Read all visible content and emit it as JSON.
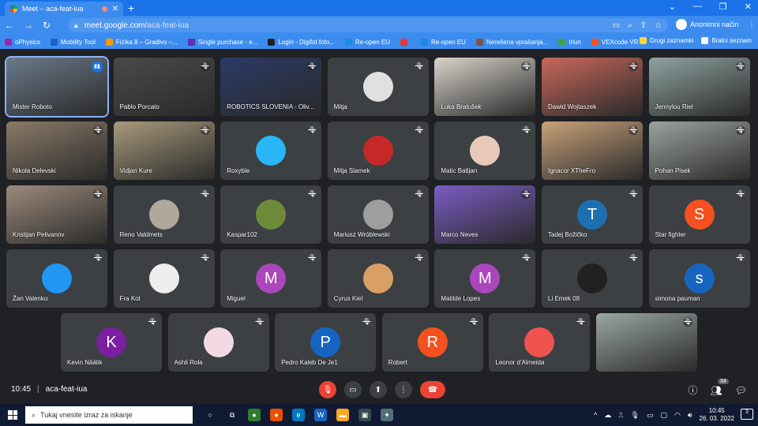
{
  "browser": {
    "tab_title": "Meet – aca-feat-iua",
    "url_host": "meet.google.com",
    "url_path": "/aca-feat-iua",
    "profile_label": "Anonimni način"
  },
  "bookmarks": [
    {
      "label": "oPhysics",
      "color": "#9c27b0"
    },
    {
      "label": "Mobility Tool",
      "color": "#1565c0"
    },
    {
      "label": "Fizika 8 – Gradivo –...",
      "color": "#ff9800"
    },
    {
      "label": "Single purchase - e...",
      "color": "#5e35b1"
    },
    {
      "label": "Login - Digifot foto...",
      "color": "#212121"
    },
    {
      "label": "Re-open EU",
      "color": "#1e88e5"
    },
    {
      "label": "",
      "color": "#e53935"
    },
    {
      "label": "Re-open EU",
      "color": "#1e88e5"
    },
    {
      "label": "Nerešena vprašanja...",
      "color": "#795548"
    },
    {
      "label": "Iriun",
      "color": "#43a047"
    },
    {
      "label": "VEXcode VR",
      "color": "#f4511e"
    }
  ],
  "bookmarks_right": {
    "other": "Drugi zaznamki",
    "reading": "Bralni seznam"
  },
  "participants": [
    {
      "name": "Mister Roboto",
      "type": "video",
      "bg": "#6b7a8a",
      "speaking": true
    },
    {
      "name": "Pablo Porcato",
      "type": "video",
      "bg": "#4a4a4a"
    },
    {
      "name": "ROBOTICS SLOVENIA - Oliv...",
      "type": "video",
      "bg": "#2b3a67"
    },
    {
      "name": "Mitja",
      "type": "avatar",
      "bg": "#e0e0e0",
      "initial": ""
    },
    {
      "name": "Luka Bratušek",
      "type": "video",
      "bg": "#d8d4cc"
    },
    {
      "name": "Dawid Wojtaszek",
      "type": "video",
      "bg": "#c8685a"
    },
    {
      "name": "Jennylou Riel",
      "type": "video",
      "bg": "#8fa3a0"
    },
    {
      "name": "Nikola Delevski",
      "type": "video",
      "bg": "#8a7a68"
    },
    {
      "name": "Vidjan Kure",
      "type": "video",
      "bg": "#a89a7c"
    },
    {
      "name": "Roxyble",
      "type": "avatar",
      "bg": "#29b6f6",
      "initial": ""
    },
    {
      "name": "Mitja Slamek",
      "type": "avatar",
      "bg": "#c62828",
      "initial": ""
    },
    {
      "name": "Matic Batljan",
      "type": "avatar",
      "bg": "#e8c9b8",
      "initial": ""
    },
    {
      "name": "Ignacor XTheFro",
      "type": "video",
      "bg": "#c9a27a"
    },
    {
      "name": "Pohan Pisek",
      "type": "video",
      "bg": "#9ba39f"
    },
    {
      "name": "Kristijan Pelivanov",
      "type": "video",
      "bg": "#9c8a7c"
    },
    {
      "name": "Reno Valdmets",
      "type": "avatar",
      "bg": "#b0a89a",
      "initial": ""
    },
    {
      "name": "Kaspar102",
      "type": "avatar",
      "bg": "#6d8a3a",
      "initial": ""
    },
    {
      "name": "Mariusz Wróblewski",
      "type": "avatar",
      "bg": "#9e9e9e",
      "initial": ""
    },
    {
      "name": "Marco Neves",
      "type": "video",
      "bg": "#7b5cc4"
    },
    {
      "name": "Tadej Božičko",
      "type": "avatar",
      "bg": "#1e6fb0",
      "initial": "T"
    },
    {
      "name": "Star fighter",
      "type": "avatar",
      "bg": "#f4511e",
      "initial": "S"
    },
    {
      "name": "Žan Valenko",
      "type": "avatar",
      "bg": "#2196f3",
      "initial": ""
    },
    {
      "name": "Fra Kol",
      "type": "avatar",
      "bg": "#eeeeee",
      "initial": ""
    },
    {
      "name": "Miguel",
      "type": "avatar",
      "bg": "#ab47bc",
      "initial": "M"
    },
    {
      "name": "Cyrus Kiel",
      "type": "avatar",
      "bg": "#d9a066",
      "initial": ""
    },
    {
      "name": "Matilde Lopes",
      "type": "avatar",
      "bg": "#ab47bc",
      "initial": "M"
    },
    {
      "name": "Li Emek 08",
      "type": "avatar",
      "bg": "#212121",
      "initial": ""
    },
    {
      "name": "simona pauman",
      "type": "avatar",
      "bg": "#1565c0",
      "initial": "s"
    },
    {
      "name": "Kevin Näälik",
      "type": "avatar",
      "bg": "#7b1fa2",
      "initial": "K"
    },
    {
      "name": "Ashli Rola",
      "type": "avatar",
      "bg": "#f3d9e3",
      "initial": ""
    },
    {
      "name": "Pedro Kaleb De Je1",
      "type": "avatar",
      "bg": "#1565c0",
      "initial": "P"
    },
    {
      "name": "Robert",
      "type": "avatar",
      "bg": "#f4511e",
      "initial": "R"
    },
    {
      "name": "Leonor d'Almeida",
      "type": "avatar",
      "bg": "#ef5350",
      "initial": ""
    },
    {
      "name": "",
      "type": "video",
      "bg": "#9aa7a2"
    }
  ],
  "meeting": {
    "time": "10:45",
    "code": "aca-feat-iua",
    "participant_count": "34"
  },
  "taskbar": {
    "search_placeholder": "Tukaj vnesite izraz za iskanje",
    "time": "10:45",
    "date": "26. 03. 2022",
    "notifications": "3"
  }
}
